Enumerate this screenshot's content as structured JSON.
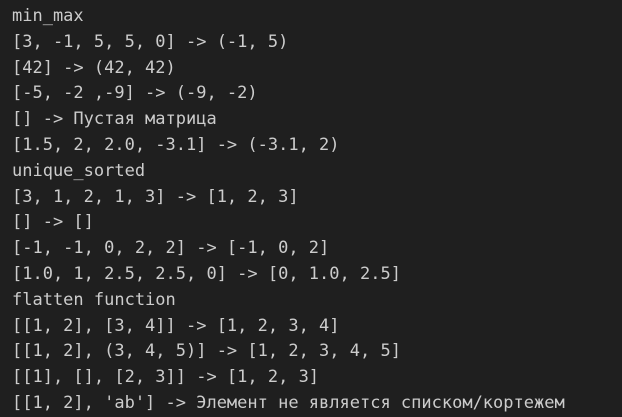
{
  "terminal": {
    "lines": [
      "min_max",
      "[3, -1, 5, 5, 0] -> (-1, 5)",
      "[42] -> (42, 42)",
      "[-5, -2 ,-9] -> (-9, -2)",
      "[] -> Пустая матрица",
      "[1.5, 2, 2.0, -3.1] -> (-3.1, 2)",
      "unique_sorted",
      "[3, 1, 2, 1, 3] -> [1, 2, 3]",
      "[] -> []",
      "[-1, -1, 0, 2, 2] -> [-1, 0, 2]",
      "[1.0, 1, 2.5, 2.5, 0] -> [0, 1.0, 2.5]",
      "flatten function",
      "[[1, 2], [3, 4]] -> [1, 2, 3, 4]",
      "[[1, 2], (3, 4, 5)] -> [1, 2, 3, 4, 5]",
      "[[1], [], [2, 3]] -> [1, 2, 3]",
      "[[1, 2], 'ab'] -> Элемент не является списком/кортежем"
    ],
    "colors": {
      "background": "#1f1f1f",
      "text": "#cccccc"
    }
  }
}
